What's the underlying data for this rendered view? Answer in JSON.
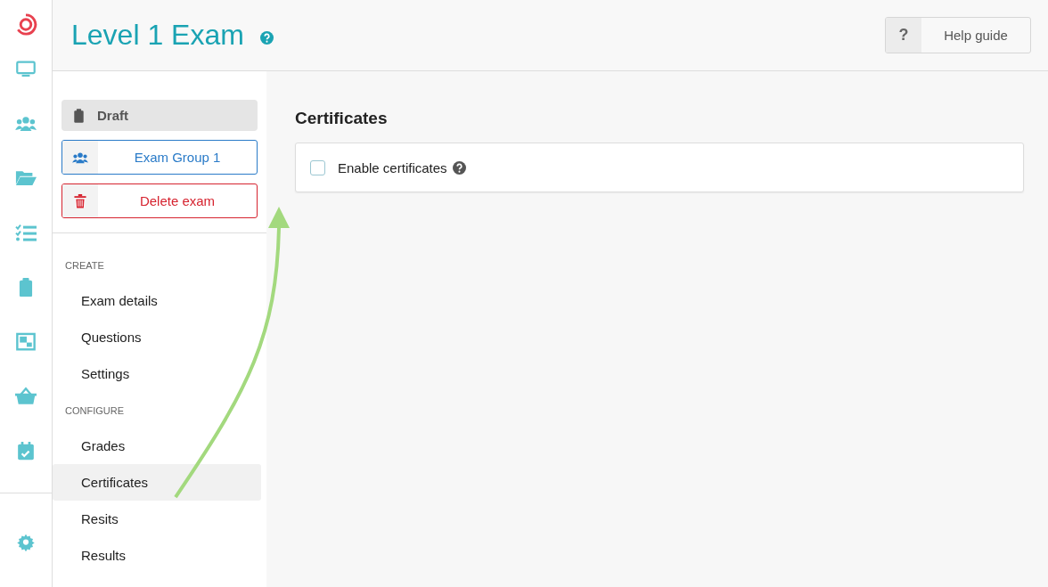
{
  "header": {
    "title": "Level 1 Exam",
    "help_button": {
      "icon_text": "?",
      "label": "Help guide"
    }
  },
  "sidebar": {
    "status": "Draft",
    "group_button": "Exam Group 1",
    "delete_button": "Delete exam",
    "sections": [
      {
        "heading": "CREATE",
        "items": [
          {
            "label": "Exam details",
            "selected": false
          },
          {
            "label": "Questions",
            "selected": false
          },
          {
            "label": "Settings",
            "selected": false
          }
        ]
      },
      {
        "heading": "CONFIGURE",
        "items": [
          {
            "label": "Grades",
            "selected": false
          },
          {
            "label": "Certificates",
            "selected": true
          },
          {
            "label": "Resits",
            "selected": false
          },
          {
            "label": "Results",
            "selected": false
          }
        ]
      }
    ]
  },
  "main": {
    "heading": "Certificates",
    "option": {
      "label": "Enable certificates",
      "checked": false
    }
  }
}
